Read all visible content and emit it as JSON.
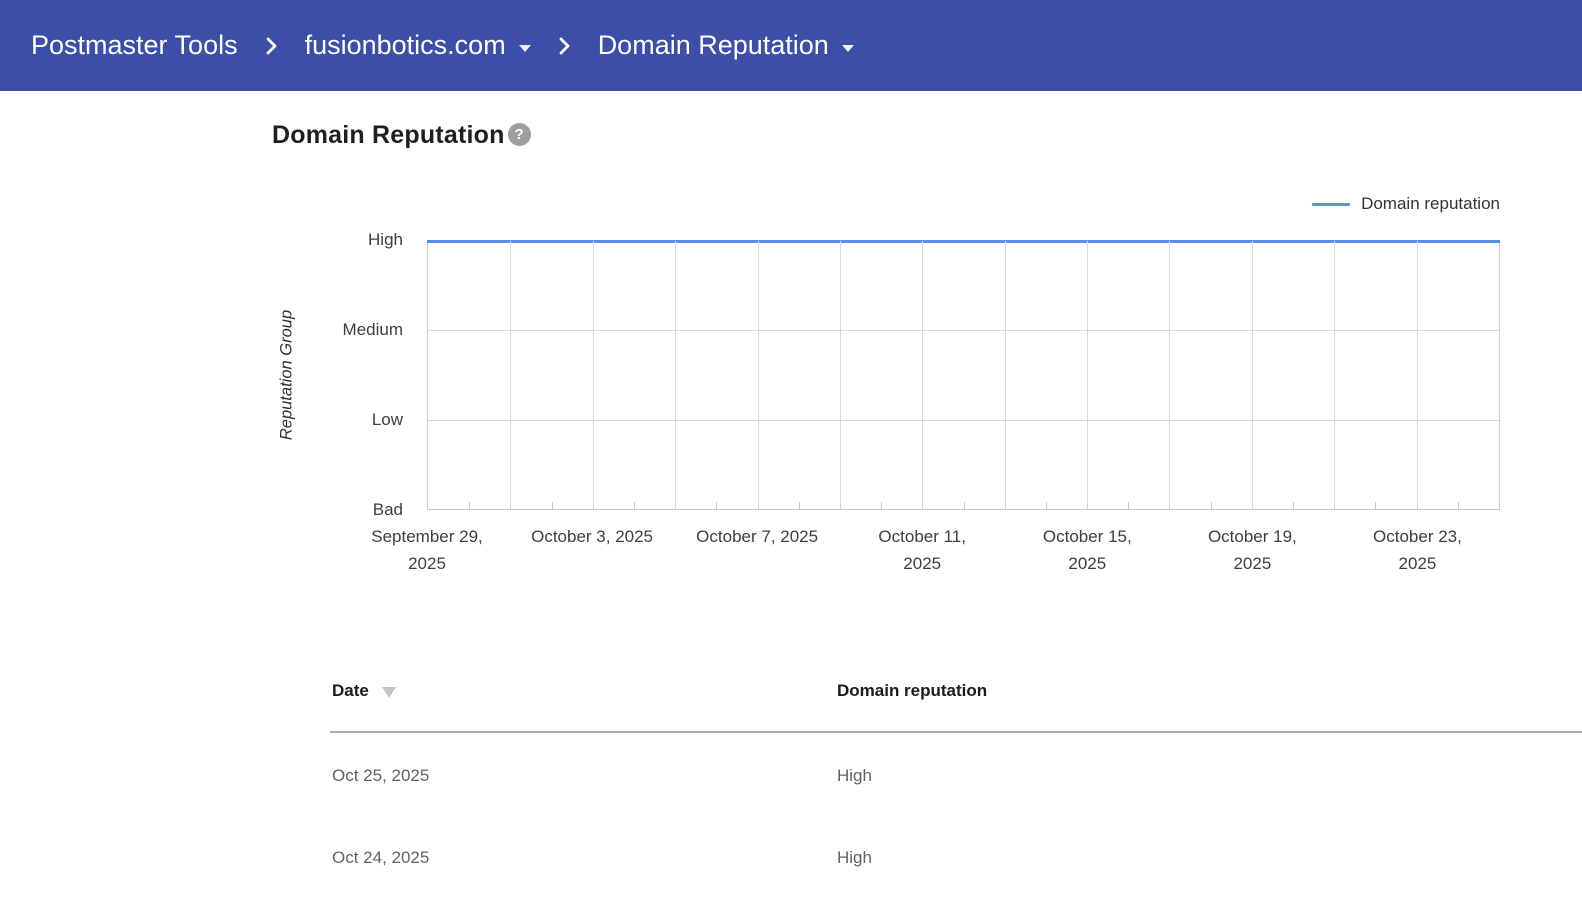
{
  "colors": {
    "header_bg": "#3d4ea9",
    "series_blue": "#5b8de8",
    "gridline": "#d8d8d8"
  },
  "header": {
    "breadcrumb": [
      {
        "label": "Postmaster Tools"
      },
      {
        "label": "fusionbotics.com"
      },
      {
        "label": "Domain Reputation"
      }
    ]
  },
  "page": {
    "title": "Domain Reputation"
  },
  "chart_data": {
    "type": "line",
    "title": "Domain Reputation",
    "ylabel": "Reputation Group",
    "y_ticks": [
      "High",
      "Medium",
      "Low",
      "Bad"
    ],
    "x_start": "September 29, 2025",
    "x_end": "October 25, 2025",
    "x_total_days": 26,
    "gridline_every_days": 2,
    "minor_tick_every_days": 1,
    "label_every_days": 4,
    "x_tick_labels": [
      "September 29,\n2025",
      "October 3, 2025",
      "October 7, 2025",
      "October 11,\n2025",
      "October 15,\n2025",
      "October 19,\n2025",
      "October 23,\n2025"
    ],
    "legend": {
      "label": "Domain reputation",
      "position": "top-right"
    },
    "series": [
      {
        "name": "Domain reputation",
        "color": "#5b8de8",
        "constant_value": "High",
        "points": [
          {
            "date": "September 29, 2025",
            "value": "High"
          },
          {
            "date": "October 25, 2025",
            "value": "High"
          }
        ]
      }
    ]
  },
  "table": {
    "columns": [
      {
        "label": "Date",
        "sorted": "desc"
      },
      {
        "label": "Domain reputation"
      }
    ],
    "rows": [
      {
        "date": "Oct 25, 2025",
        "value": "High"
      },
      {
        "date": "Oct 24, 2025",
        "value": "High"
      }
    ]
  }
}
